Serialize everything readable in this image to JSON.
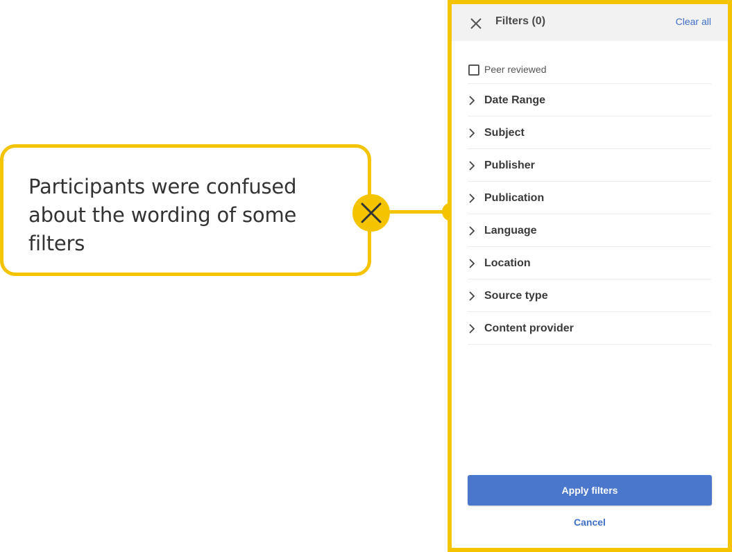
{
  "callout": {
    "text": "Participants were confused about the wording of some filters",
    "icon": "close-icon",
    "accent_color": "#f5c400"
  },
  "panel": {
    "title": "Filters (0)",
    "clear_all_label": "Clear all",
    "close_icon": "close-icon",
    "peer_reviewed": {
      "label": "Peer reviewed",
      "checked": false
    },
    "filters": [
      {
        "label": "Date Range"
      },
      {
        "label": "Subject"
      },
      {
        "label": "Publisher"
      },
      {
        "label": "Publication"
      },
      {
        "label": "Language"
      },
      {
        "label": "Location"
      },
      {
        "label": "Source type"
      },
      {
        "label": "Content provider"
      }
    ],
    "apply_label": "Apply filters",
    "cancel_label": "Cancel",
    "link_color": "#3f6fc9",
    "button_color": "#4a77cc"
  }
}
